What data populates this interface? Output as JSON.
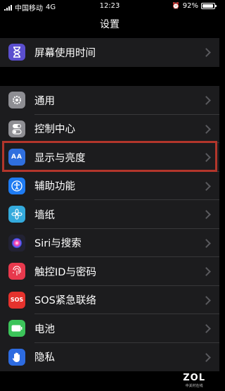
{
  "status_bar": {
    "carrier": "中国移动",
    "network": "4G",
    "time": "12:23",
    "battery_percent": "92%",
    "battery_level": 0.92
  },
  "header": {
    "title": "设置"
  },
  "screen_time_group": {
    "items": [
      {
        "label": "屏幕使用时间",
        "icon": "hourglass-icon",
        "color": "#5b4fcf"
      }
    ]
  },
  "settings_group": {
    "items": [
      {
        "label": "通用",
        "icon": "gear-icon",
        "color": "#8e8e93"
      },
      {
        "label": "控制中心",
        "icon": "toggles-icon",
        "color": "#8e8e93"
      },
      {
        "label": "显示与亮度",
        "icon": "text-size-icon",
        "color": "#2f6fde"
      },
      {
        "label": "辅助功能",
        "icon": "accessibility-icon",
        "color": "#1e7bf2"
      },
      {
        "label": "墙纸",
        "icon": "flower-icon",
        "color": "#34aadc"
      },
      {
        "label": "Siri与搜索",
        "icon": "siri-icon",
        "color": "#222233"
      },
      {
        "label": "触控ID与密码",
        "icon": "fingerprint-icon",
        "color": "#e8394d"
      },
      {
        "label": "SOS紧急联络",
        "icon": "sos-icon",
        "color": "#e5322d"
      },
      {
        "label": "电池",
        "icon": "battery-icon",
        "color": "#3cc45a"
      },
      {
        "label": "隐私",
        "icon": "hand-icon",
        "color": "#2d6be0"
      }
    ]
  },
  "watermark": {
    "brand": "ZOL",
    "sub": "中关村在线"
  },
  "highlight_color": "#b3362b"
}
